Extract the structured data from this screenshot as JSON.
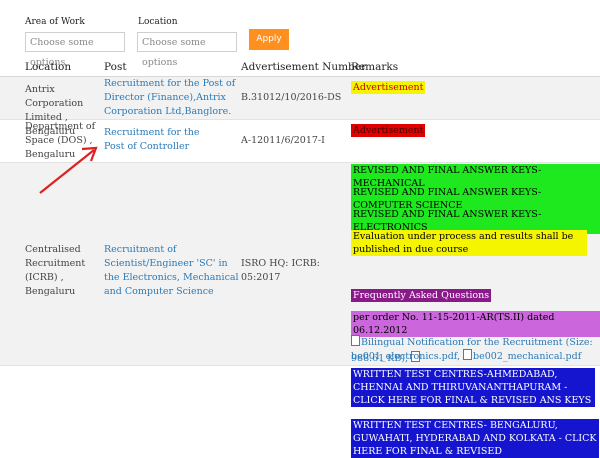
{
  "filters": {
    "area_label": "Area of Work",
    "location_label": "Location",
    "area_placeholder": "Choose some options",
    "location_placeholder": "Choose some options",
    "apply_label": "Apply"
  },
  "table": {
    "headers": [
      "Location",
      "Post",
      "Advertisement Number",
      "Remarks"
    ],
    "rows": [
      {
        "location": "Antrix Corporation Limited , Bengaluru",
        "post": "Recruitment for the Post of Director (Finance),Antrix Corporation Ltd,Banglore.",
        "adv": "B.31012/10/2016-DS",
        "remarks": [
          "Advertisement"
        ]
      },
      {
        "location": "Department of Space (DOS) , Bengaluru",
        "post": "Recruitment for the Post of Controller",
        "adv": "A-12011/6/2017-I",
        "remarks": [
          "Advertisement"
        ]
      },
      {
        "location": "Centralised Recruitment (ICRB) , Bengaluru",
        "post": "Recruitment of Scientist/Engineer 'SC' in the Electronics, Mechanical and Computer Science",
        "adv": "ISRO HQ: ICRB: 05:2017",
        "remarks": [
          "REVISED AND FINAL ANSWER KEYS-MECHANICAL",
          "REVISED AND FINAL ANSWER KEYS-COMPUTER SCIENCE",
          "REVISED AND FINAL ANSWER KEYS-ELECTRONICS",
          "Evaluation under process and results shall be published in due course",
          "Frequently Asked Questions",
          "per order No. 11-15-2011-AR(TS.II) dated 06.12.2012",
          "Bilingual Notification for the Recruitment (Size: 988.61 KB),",
          "be001_electronics.pdf,",
          "be002_mechanical.pdf"
        ]
      },
      {
        "remarks": [
          "WRITTEN TEST CENTRES-AHMEDABAD, CHENNAI AND THIRUVANANTHAPURAM - CLICK HERE FOR FINAL & REVISED ANS KEYS",
          "WRITTEN TEST CENTRES- BENGALURU, GUWAHATI, HYDERABAD AND KOLKATA - CLICK HERE FOR FINAL & REVISED"
        ]
      }
    ]
  },
  "colors": {
    "accent_orange": "#ff8f1f",
    "link_blue": "#2a7ab8",
    "highlight_yellow": "#f5f500",
    "highlight_red": "#e00000",
    "highlight_green": "#1ee81e",
    "highlight_purple": "#8a1a8a",
    "highlight_violet": "#cc66dd",
    "highlight_blue": "#1515d0",
    "arrow_red": "#e02020"
  }
}
